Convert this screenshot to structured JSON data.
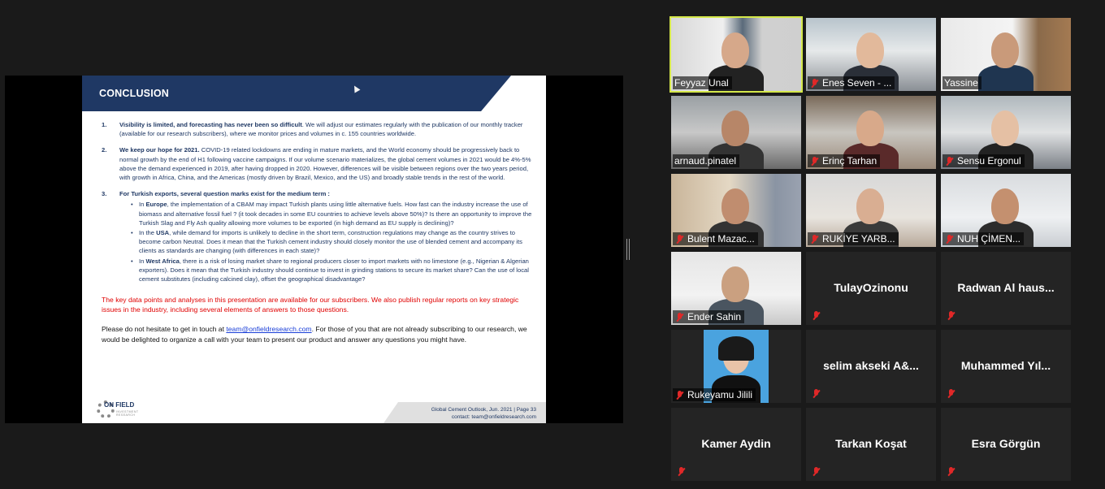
{
  "slide": {
    "title": "CONCLUSION",
    "points": [
      {
        "num": "1.",
        "bold": "Visibility is limited, and forecasting has never been so difficult",
        "text": ". We will adjust our estimates regularly with the publication of our monthly tracker (available for our research subscribers), where we monitor prices and volumes in c. 155 countries worldwide."
      },
      {
        "num": "2.",
        "bold": "We keep our hope for 2021.",
        "text": " COVID-19 related lockdowns are ending in mature markets, and the World economy should be progressively back to normal growth by the end of H1 following vaccine campaigns. If our volume scenario materializes, the global cement volumes in 2021 would be 4%-5% above the demand experienced in 2019, after having dropped in 2020. However, differences will be visible between regions over the two years period, with growth in Africa, China, and the Americas (mostly driven by Brazil, Mexico, and the US) and broadly stable trends in the rest of the world."
      },
      {
        "num": "3.",
        "bold": "For Turkish exports,  several question marks exist for the medium term :",
        "text": ""
      }
    ],
    "sub_points": [
      {
        "prefix": "In ",
        "bold": "Europe",
        "text": ", the implementation of a CBAM may impact Turkish plants using little alternative fuels. How fast can the industry increase the use of biomass and alternative fossil fuel ? (it took decades in some EU countries to achieve levels above 50%)?  Is there an opportunity to improve the Turkish Slag and Fly Ash quality allowing more volumes to be exported (in high demand as EU supply is declining)?"
      },
      {
        "prefix": "In the ",
        "bold": "USA",
        "text": ", while demand  for imports is unlikely to decline in the short term, construction regulations may change as the country strives to become carbon Neutral. Does it mean that the Turkish cement industry should closely monitor the use of blended cement and accompany its clients as standards are changing (with differences in each state)?"
      },
      {
        "prefix": "In ",
        "bold": "West Africa",
        "text": ", there is a risk of losing market share to regional producers closer to import markets with no limestone (e.g., Nigerian & Algerian exporters). Does it mean that the Turkish industry should continue to invest in grinding stations to secure its market share? Can the use of local cement substitutes (including calcined clay), offset the geographical disadvantage?"
      }
    ],
    "red_note": "The key data points and analyses in this presentation are available for our subscribers. We also publish regular reports on key strategic issues in the industry, including several elements of answers to those questions.",
    "contact_before": "Please do not hesitate to get in touch at ",
    "contact_email": "team@onfieldresearch.com",
    "contact_after": ". For those of you that are not already subscribing to our research, we would be delighted to organize a call with your team to present our product and answer any questions you might have.",
    "footer_line1": "Global Cement Outlook, Jun. 2021 | Page 33",
    "footer_line2": "contact: team@onfieldresearch.com",
    "logo_text": "ON FIELD",
    "logo_sub": "INVESTMENT RESEARCH"
  },
  "participants": [
    {
      "name": "Feyyaz Unal",
      "muted": false,
      "video": true,
      "active": true
    },
    {
      "name": "Enes Seven - ...",
      "muted": true,
      "video": true
    },
    {
      "name": "Yassine",
      "muted": false,
      "video": true
    },
    {
      "name": "arnaud.pinatel",
      "muted": false,
      "video": true
    },
    {
      "name": "Erinç Tarhan",
      "muted": true,
      "video": true
    },
    {
      "name": "Sensu Ergonul",
      "muted": true,
      "video": true
    },
    {
      "name": "Bulent Mazac...",
      "muted": true,
      "video": true
    },
    {
      "name": "RUKİYE YARB...",
      "muted": true,
      "video": true
    },
    {
      "name": "NUH ÇİMEN...",
      "muted": true,
      "video": true
    },
    {
      "name": "Ender Sahin",
      "muted": true,
      "video": true
    },
    {
      "name": "TulayOzinonu",
      "muted": true,
      "video": false
    },
    {
      "name": "Radwan Al haus...",
      "muted": true,
      "video": false
    },
    {
      "name": "Rukeyamu Jilili",
      "muted": true,
      "video": true
    },
    {
      "name": "selim  akseki A&...",
      "muted": true,
      "video": false
    },
    {
      "name": "Muhammed  Yıl...",
      "muted": true,
      "video": false
    },
    {
      "name": "Kamer Aydin",
      "muted": true,
      "video": false
    },
    {
      "name": "Tarkan Koşat",
      "muted": true,
      "video": false
    },
    {
      "name": "Esra Görgün",
      "muted": true,
      "video": false
    }
  ],
  "colors": {
    "slide_header": "#1f3864",
    "active_speaker": "#d5e84a",
    "muted_icon": "#e02828",
    "red_note": "#e00000"
  },
  "icons": {
    "muted": "microphone-muted-icon"
  }
}
